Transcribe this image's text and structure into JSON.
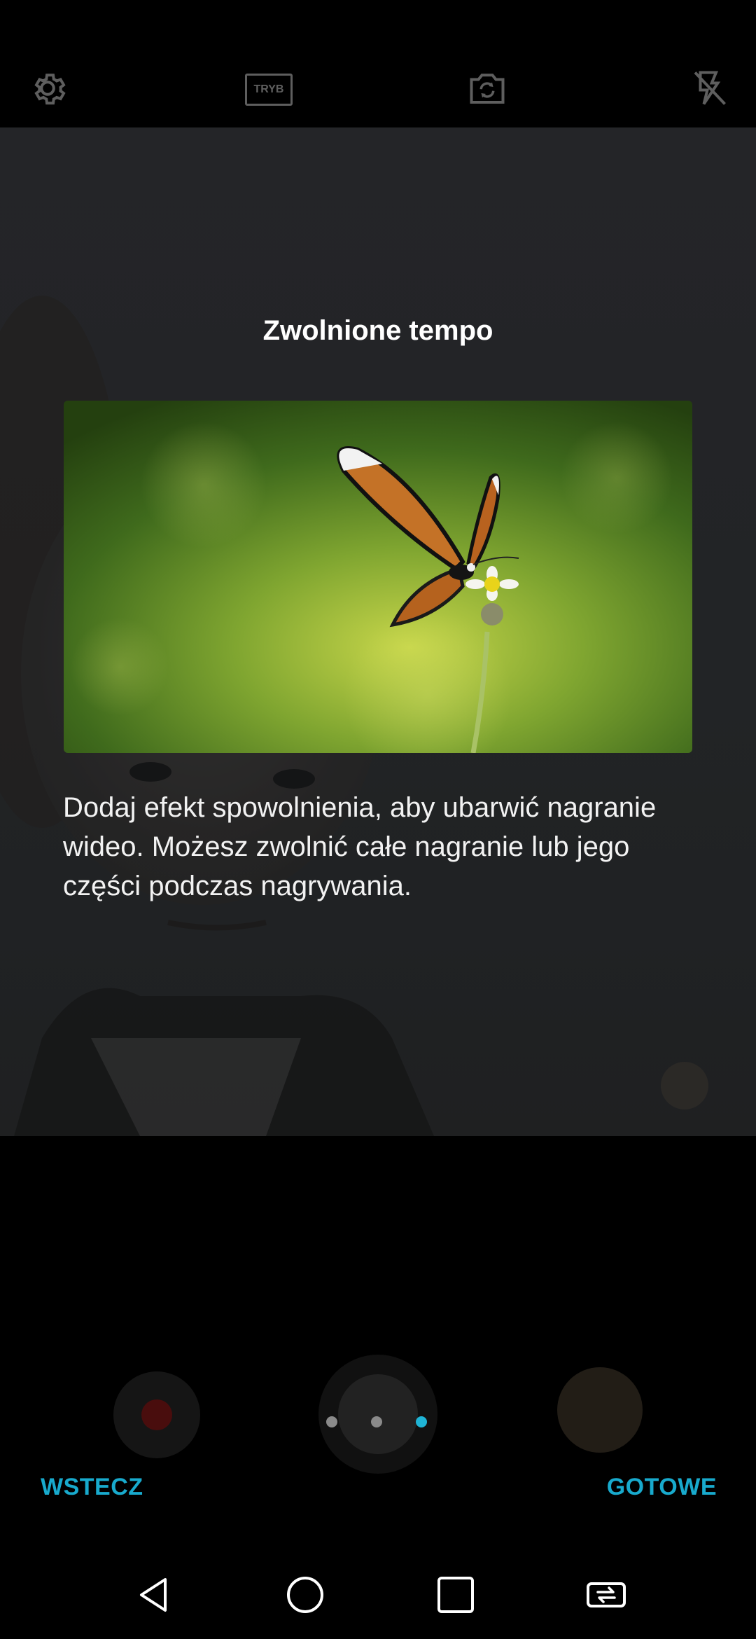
{
  "topbar": {
    "settings_icon": "gear-icon",
    "mode_label": "TRYB",
    "switch_camera_icon": "camera-switch-icon",
    "flash_icon": "flash-off-icon"
  },
  "tutorial": {
    "title": "Zwolnione tempo",
    "description": "Dodaj efekt spowolnienia, aby ubarwić nagranie wideo. Możesz zwolnić całe nagranie lub jego części podczas nagrywania.",
    "preview_image": "butterfly-on-flower",
    "page_count": 3,
    "active_page": 3
  },
  "actions": {
    "back_label": "WSTECZ",
    "done_label": "GOTOWE"
  },
  "colors": {
    "accent": "#18aacd",
    "background": "#000000"
  },
  "navbar": {
    "back_icon": "nav-back-icon",
    "home_icon": "nav-home-icon",
    "recents_icon": "nav-recents-icon",
    "rotate_icon": "screen-rotate-icon"
  }
}
